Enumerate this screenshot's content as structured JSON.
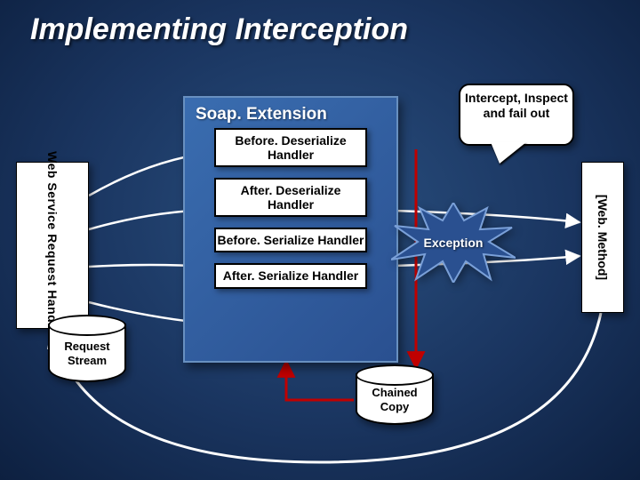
{
  "title": "Implementing Interception",
  "soap": {
    "heading": "Soap. Extension",
    "stages": [
      "Before. Deserialize Handler",
      "After. Deserialize Handler",
      "Before. Serialize Handler",
      "After. Serialize Handler"
    ]
  },
  "left_bar": "Web Service Request Handler",
  "right_bar": "[Web. Method]",
  "request_stream": "Request Stream",
  "chained_copy": "Chained Copy",
  "callout": "Intercept, Inspect and fail out",
  "exception": "Exception"
}
